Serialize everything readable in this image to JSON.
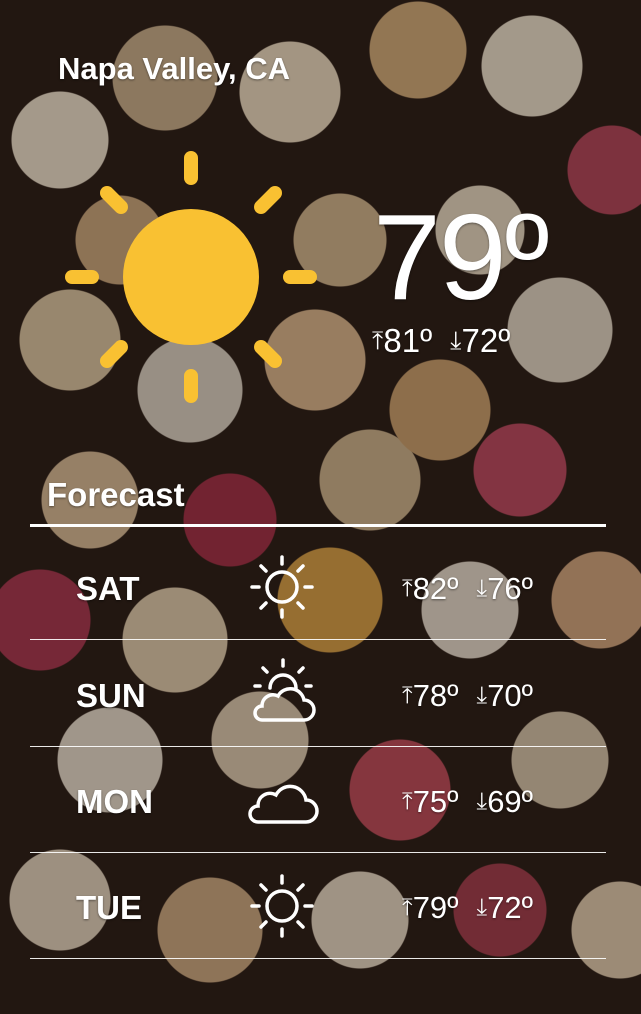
{
  "location": "Napa Valley, CA",
  "current": {
    "temperature": "79º",
    "high_arrow": "⤒",
    "high": "81º",
    "low_arrow": "⤓",
    "low": "72º",
    "condition_icon": "sun-icon",
    "icon_color": "#f9c132"
  },
  "forecast": {
    "title": "Forecast",
    "days": [
      {
        "day": "SAT",
        "icon": "sunny-icon",
        "high_arrow": "⤒",
        "high": "82º",
        "low_arrow": "⤓",
        "low": "76º"
      },
      {
        "day": "SUN",
        "icon": "partly-cloudy-icon",
        "high_arrow": "⤒",
        "high": "78º",
        "low_arrow": "⤓",
        "low": "70º"
      },
      {
        "day": "MON",
        "icon": "cloudy-icon",
        "high_arrow": "⤒",
        "high": "75º",
        "low_arrow": "⤓",
        "low": "69º"
      },
      {
        "day": "TUE",
        "icon": "sunny-icon",
        "high_arrow": "⤒",
        "high": "79º",
        "low_arrow": "⤓",
        "low": "72º"
      }
    ]
  }
}
